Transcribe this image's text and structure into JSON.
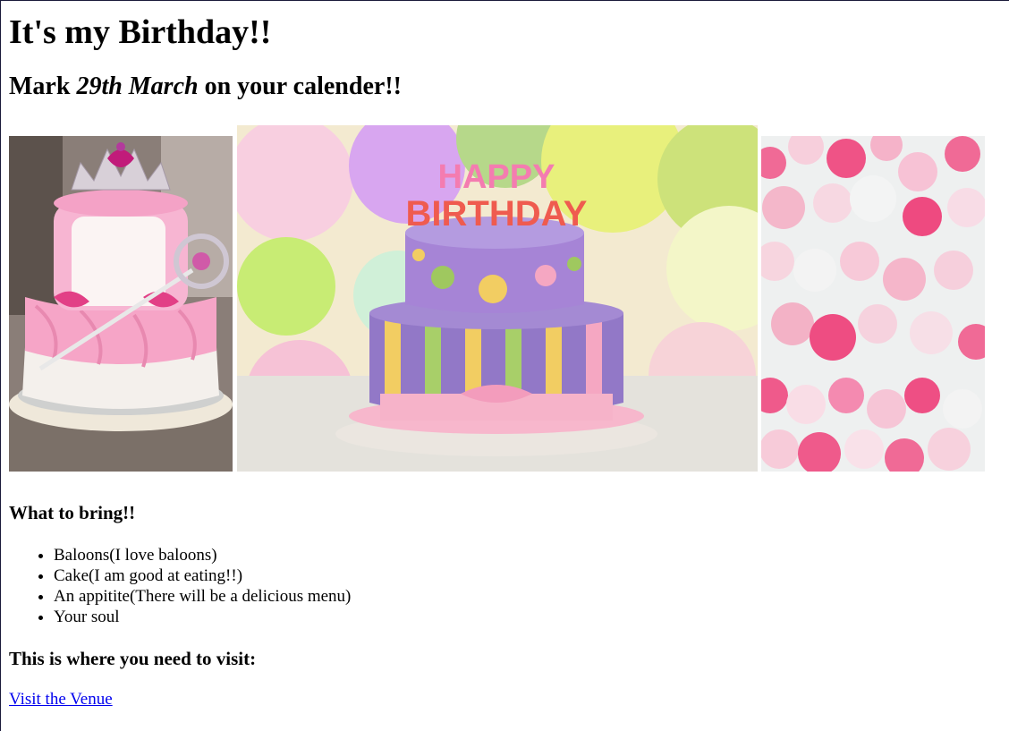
{
  "page": {
    "title": "It's my Birthday!!",
    "subtitle": {
      "prefix": "Mark ",
      "emphasis": "29th March",
      "suffix": " on your calender!!"
    },
    "images": [
      {
        "name": "princess-cake-photo",
        "subject": "pink princess cake with tiara and wand"
      },
      {
        "name": "happy-birthday-cake-photo",
        "subject": "two-tier purple birthday cake with candles spelling HAPPY BIRTHDAY"
      },
      {
        "name": "pink-balloons-photo",
        "subject": "pink and white balloons"
      }
    ],
    "bring_heading": "What to bring!!",
    "bring_items": [
      "Baloons(I love baloons)",
      "Cake(I am good at eating!!)",
      "An appitite(There will be a delicious menu)",
      "Your soul"
    ],
    "visit_heading": "This is where you need to visit:",
    "venue_link": "Visit the Venue"
  },
  "colors": {
    "link": "#0000ee",
    "text": "#000000"
  }
}
